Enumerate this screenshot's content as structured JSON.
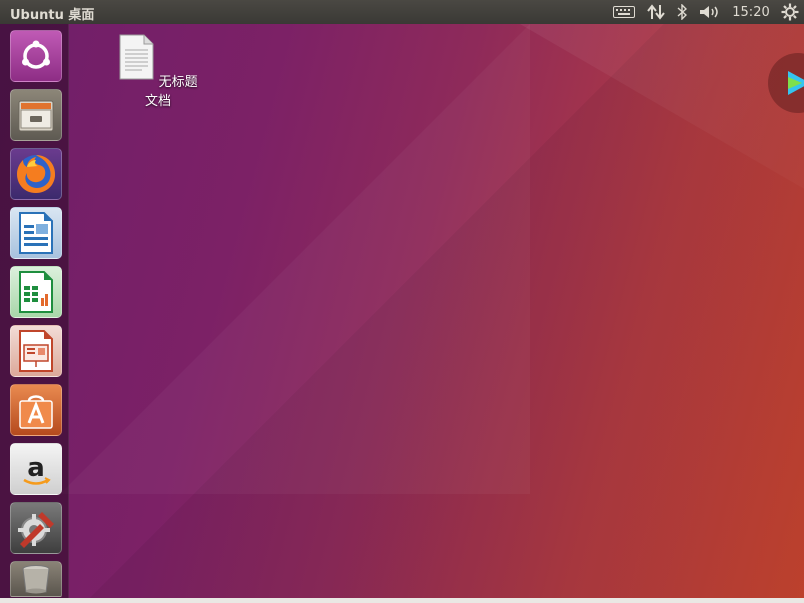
{
  "topbar": {
    "app_title": "Ubuntu 桌面",
    "time": "15:20",
    "indicators": [
      "keyboard-icon",
      "network-arrows-icon",
      "bluetooth-icon",
      "volume-icon"
    ],
    "power_icon": "gear-icon"
  },
  "launcher": {
    "items": [
      {
        "name": "ubuntu-logo-icon",
        "color": "#a23d94"
      },
      {
        "name": "file-cabinet-icon",
        "color": "#8a8479"
      },
      {
        "name": "firefox-icon",
        "color": "#e76a1f"
      },
      {
        "name": "libreoffice-writer-icon",
        "color": "#2a72b8"
      },
      {
        "name": "libreoffice-calc-icon",
        "color": "#1e8e3e"
      },
      {
        "name": "libreoffice-impress-icon",
        "color": "#c0462b"
      },
      {
        "name": "ubuntu-software-icon",
        "color": "#e8681e"
      },
      {
        "name": "amazon-icon",
        "color": "#222222"
      },
      {
        "name": "system-settings-icon",
        "color": "#c0392b"
      },
      {
        "name": "trash-icon",
        "color": "#9c9991"
      }
    ]
  },
  "desktop": {
    "file_label": "无标题文档"
  },
  "colors": {
    "panel": "#3c3b37",
    "accent": "#e95420"
  }
}
